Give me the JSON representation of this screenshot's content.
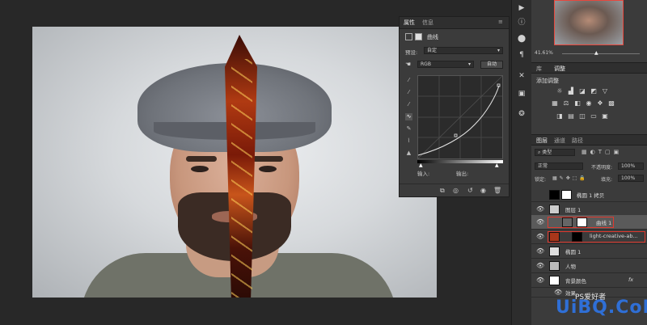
{
  "properties": {
    "tabs": [
      "属性",
      "信息"
    ],
    "adjustment_name": "曲线",
    "preset_label": "预设:",
    "preset_value": "自定",
    "channel_value": "RGB",
    "auto_button": "自动",
    "input_label": "输入:",
    "output_label": "输出:"
  },
  "navigator": {
    "zoom": "41.61%"
  },
  "adjustments": {
    "tabs": [
      "库",
      "调整"
    ],
    "add_label": "添加调整"
  },
  "layers": {
    "tabs": [
      "图层",
      "通道",
      "路径"
    ],
    "filter_kind": "类型",
    "blend_mode": "正常",
    "opacity_label": "不透明度:",
    "opacity_value": "100%",
    "lock_label": "锁定:",
    "fill_label": "填充:",
    "fill_value": "100%",
    "items": [
      {
        "name": "椭圆 1 拷贝"
      },
      {
        "name": "图层 1"
      },
      {
        "name": "曲线 1"
      },
      {
        "name": "light-creative-ab..."
      },
      {
        "name": "椭圆 1"
      },
      {
        "name": "人物"
      },
      {
        "name": "背景颜色"
      },
      {
        "name": "效果"
      }
    ],
    "fx_label": "fx"
  },
  "watermark": {
    "text": "UiBQ.CoM",
    "sub": "PS爱好者"
  },
  "colors": {
    "accent_red": "#e0392e",
    "panel": "#3b3b3b",
    "panel_dark": "#2f2f2f",
    "watermark_blue": "#2f6fd6"
  }
}
